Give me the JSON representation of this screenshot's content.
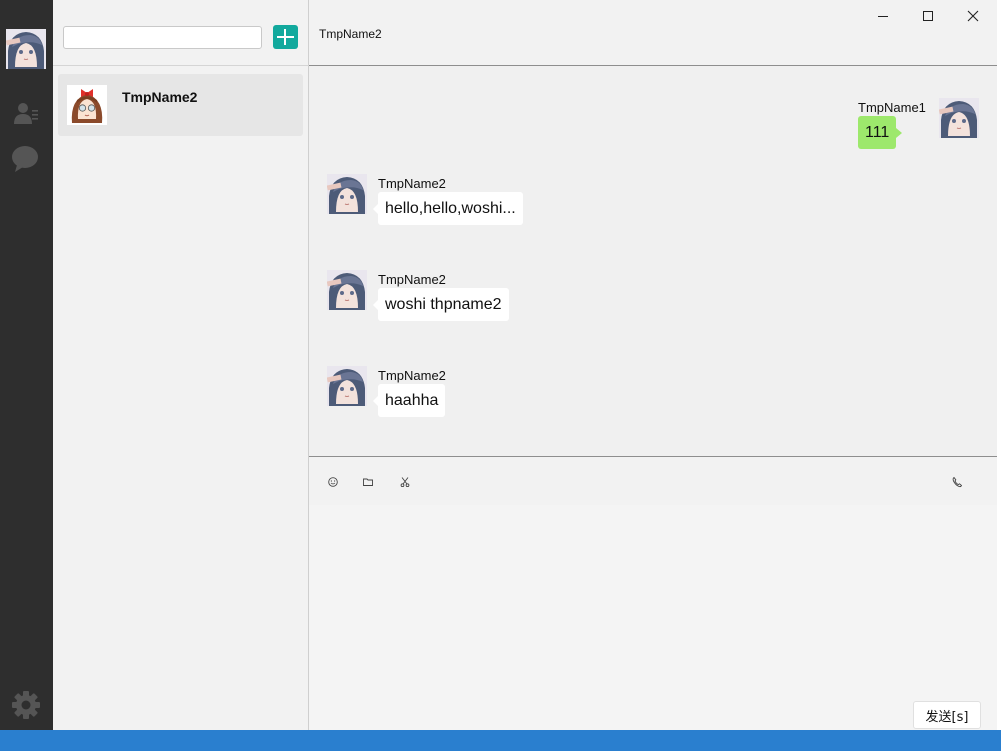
{
  "app": {
    "current_user": "TmpName1",
    "active_chat_title": "TmpName2"
  },
  "sidebar": {
    "icons": [
      "avatar",
      "contacts-icon",
      "chat-bubble-icon",
      "gear-icon"
    ]
  },
  "contacts": {
    "search": {
      "value": "",
      "placeholder": ""
    },
    "add_button_icon": "plus-icon",
    "items": [
      {
        "name": "TmpName2",
        "avatar": "girl-with-bow-avatar",
        "selected": true
      }
    ]
  },
  "window_controls": {
    "minimize": "—",
    "maximize": "☐",
    "close": "✕"
  },
  "messages": [
    {
      "sender": "TmpName1",
      "text": "111",
      "direction": "out"
    },
    {
      "sender": "TmpName2",
      "text": "hello,hello,woshi...",
      "direction": "in"
    },
    {
      "sender": "TmpName2",
      "text": "woshi thpname2",
      "direction": "in"
    },
    {
      "sender": "TmpName2",
      "text": "haahha",
      "direction": "in"
    }
  ],
  "toolbar": {
    "icons": [
      "emoji-icon",
      "folder-icon",
      "scissors-icon",
      "phone-icon"
    ]
  },
  "compose": {
    "value": "",
    "placeholder": ""
  },
  "send_button_label": "发送[s]",
  "colors": {
    "rail": "#2e2e2e",
    "accent": "#12a99d",
    "outgoing_bubble": "#9de86c",
    "taskbar": "#2a7fcf"
  }
}
